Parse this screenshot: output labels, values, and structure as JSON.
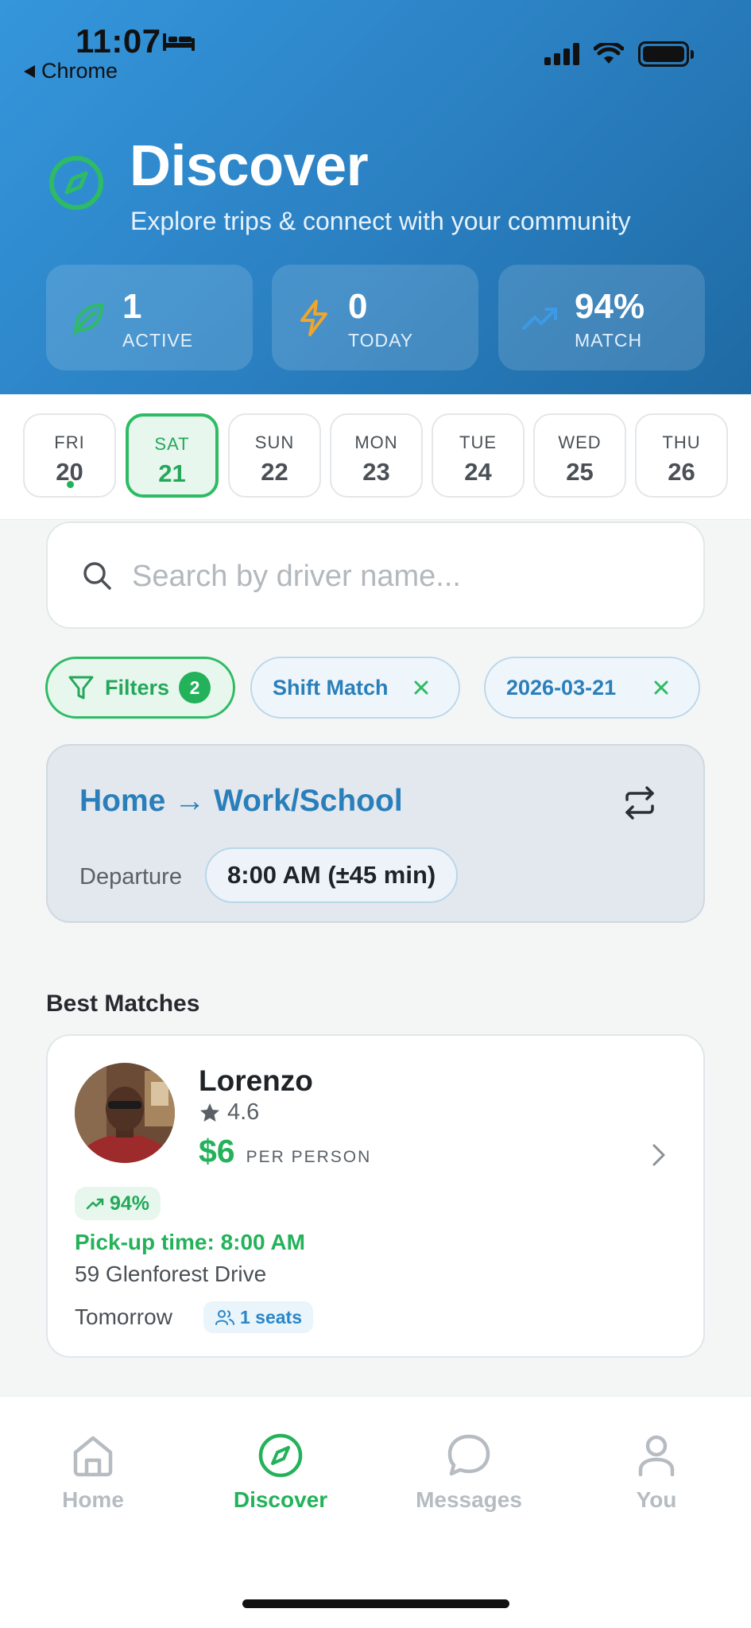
{
  "status_bar": {
    "time": "11:07",
    "back_app": "Chrome"
  },
  "header": {
    "title": "Discover",
    "subtitle": "Explore trips & connect with your community",
    "stats": [
      {
        "value": "1",
        "label": "ACTIVE",
        "icon": "leaf-icon",
        "color": "#2dbc63"
      },
      {
        "value": "0",
        "label": "TODAY",
        "icon": "lightning-icon",
        "color": "#f0a52c"
      },
      {
        "value": "94%",
        "label": "MATCH",
        "icon": "trending-up-icon",
        "color": "#3d9be6"
      }
    ]
  },
  "dates": [
    {
      "day": "FRI",
      "date": "20",
      "has_trip": true,
      "selected": false
    },
    {
      "day": "SAT",
      "date": "21",
      "has_trip": false,
      "selected": true
    },
    {
      "day": "SUN",
      "date": "22",
      "has_trip": false,
      "selected": false
    },
    {
      "day": "MON",
      "date": "23",
      "has_trip": false,
      "selected": false
    },
    {
      "day": "TUE",
      "date": "24",
      "has_trip": false,
      "selected": false
    },
    {
      "day": "WED",
      "date": "25",
      "has_trip": false,
      "selected": false
    },
    {
      "day": "THU",
      "date": "26",
      "has_trip": false,
      "selected": false
    }
  ],
  "search": {
    "placeholder": "Search by driver name...",
    "value": ""
  },
  "filters": {
    "label": "Filters",
    "count": "2",
    "chips": [
      {
        "label": "Shift Match"
      },
      {
        "label": "2026-03-21"
      }
    ]
  },
  "route": {
    "title": "Home → Work/School",
    "departure_label": "Departure",
    "departure_time": "8:00 AM (±45 min)"
  },
  "best_matches": {
    "title": "Best Matches",
    "items": [
      {
        "driver": "Lorenzo",
        "rating": "4.6",
        "price": "$6",
        "price_unit": "PER PERSON",
        "match": "94%",
        "pickup": "Pick-up time: 8:00 AM",
        "address": "59 Glenforest Drive",
        "when": "Tomorrow",
        "seats": "1 seats"
      }
    ]
  },
  "tabbar": {
    "tabs": [
      {
        "label": "Home",
        "icon": "home-icon",
        "active": false
      },
      {
        "label": "Discover",
        "icon": "compass-icon",
        "active": true
      },
      {
        "label": "Messages",
        "icon": "chat-bubble-icon",
        "active": false
      },
      {
        "label": "You",
        "icon": "person-icon",
        "active": false
      }
    ]
  },
  "colors": {
    "accent_green": "#23b25a",
    "accent_blue": "#2a7fbb",
    "header_blue": "#2a7fc0"
  }
}
